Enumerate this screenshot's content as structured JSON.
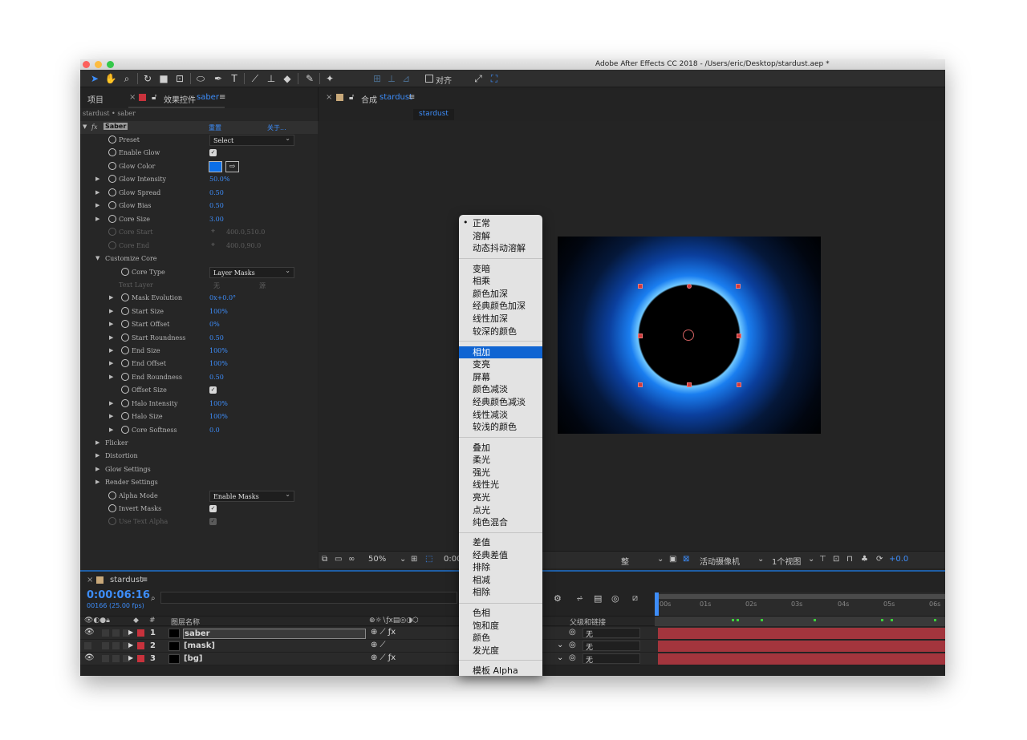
{
  "window": {
    "title": "Adobe After Effects CC 2018 - /Users/eric/Desktop/stardust.aep *"
  },
  "toolbar": {
    "snap_label": "对齐"
  },
  "effects_panel": {
    "tab_project": "项目",
    "tab_effects": "效果控件",
    "layer": "saber",
    "breadcrumb": "stardust • saber",
    "effect_name": "Saber",
    "reset": "重置",
    "about": "关于...",
    "rows": [
      {
        "label": "Preset",
        "value": "Select"
      },
      {
        "label": "Enable Glow",
        "value": "✓"
      },
      {
        "label": "Glow Color",
        "value": ""
      },
      {
        "label": "Glow Intensity",
        "value": "50.0%"
      },
      {
        "label": "Glow Spread",
        "value": "0.50"
      },
      {
        "label": "Glow Bias",
        "value": "0.50"
      },
      {
        "label": "Core Size",
        "value": "3.00"
      },
      {
        "label": "Core Start",
        "value": "400.0,510.0"
      },
      {
        "label": "Core End",
        "value": "400.0,90.0"
      },
      {
        "label": "Customize Core",
        "value": ""
      },
      {
        "label": "Core Type",
        "value": "Layer Masks"
      },
      {
        "label": "Text Layer",
        "value": "无"
      },
      {
        "label": "Mask Evolution",
        "value": "0x+0.0°"
      },
      {
        "label": "Start Size",
        "value": "100%"
      },
      {
        "label": "Start Offset",
        "value": "0%"
      },
      {
        "label": "Start Roundness",
        "value": "0.50"
      },
      {
        "label": "End Size",
        "value": "100%"
      },
      {
        "label": "End Offset",
        "value": "100%"
      },
      {
        "label": "End Roundness",
        "value": "0.50"
      },
      {
        "label": "Offset Size",
        "value": "✓"
      },
      {
        "label": "Halo Intensity",
        "value": "100%"
      },
      {
        "label": "Halo Size",
        "value": "100%"
      },
      {
        "label": "Core Softness",
        "value": "0.0"
      },
      {
        "label": "Flicker",
        "value": ""
      },
      {
        "label": "Distortion",
        "value": ""
      },
      {
        "label": "Glow Settings",
        "value": ""
      },
      {
        "label": "Render Settings",
        "value": ""
      },
      {
        "label": "Alpha Mode",
        "value": "Enable Masks"
      },
      {
        "label": "Invert Masks",
        "value": "✓"
      },
      {
        "label": "Use Text Alpha",
        "value": "✓"
      }
    ],
    "text_layer_source": "源"
  },
  "composition": {
    "tab_prefix": "合成",
    "name": "stardust",
    "sub_tab": "stardust"
  },
  "viewer_bar": {
    "zoom": "50%",
    "time": "0:00",
    "camera": "活动摄像机",
    "views": "1个视图",
    "exposure": "+0.0"
  },
  "timeline": {
    "comp": "stardust",
    "timecode": "0:00:06:16",
    "frames": "00166 (25.00 fps)",
    "search_placeholder": "",
    "col_layer_name": "图层名称",
    "col_number": "#",
    "col_parent": "父级和链接",
    "ruler": [
      "00s",
      "01s",
      "02s",
      "03s",
      "04s",
      "05s",
      "06s"
    ],
    "layers": [
      {
        "num": "1",
        "name": "saber",
        "parent": "无"
      },
      {
        "num": "2",
        "name": "[mask]",
        "parent": "无"
      },
      {
        "num": "3",
        "name": "[bg]",
        "parent": "无"
      }
    ]
  },
  "blend_menu": {
    "bullet": "•",
    "items": [
      "正常",
      "溶解",
      "动态抖动溶解",
      "变暗",
      "相乘",
      "颜色加深",
      "经典颜色加深",
      "线性加深",
      "较深的颜色",
      "相加",
      "变亮",
      "屏幕",
      "颜色减淡",
      "经典颜色减淡",
      "线性减淡",
      "较浅的颜色",
      "叠加",
      "柔光",
      "强光",
      "线性光",
      "亮光",
      "点光",
      "纯色混合",
      "差值",
      "经典差值",
      "排除",
      "相减",
      "相除",
      "色相",
      "饱和度",
      "颜色",
      "发光度",
      "模板 Alpha"
    ],
    "selected": "相加"
  },
  "colors": {
    "accent": "#3d8dfa",
    "selection": "#0f64d2",
    "glow": "#1a7ef0",
    "label_red": "#c8323c"
  }
}
